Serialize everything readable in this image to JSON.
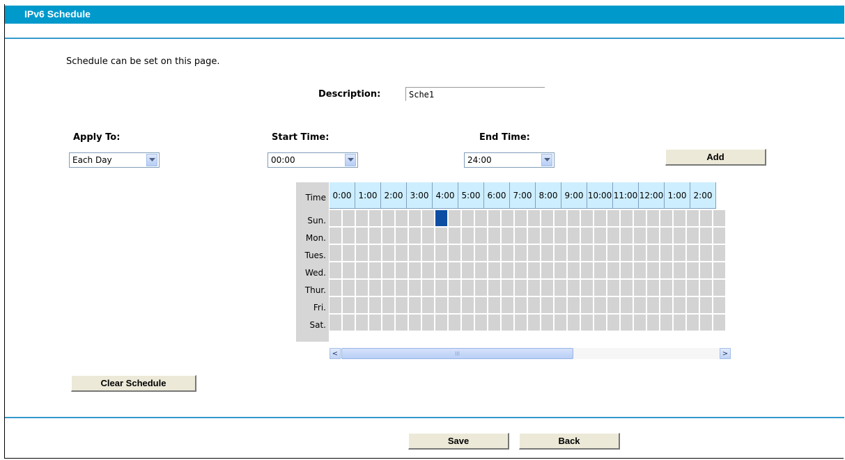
{
  "title": "IPv6 Schedule",
  "intro": "Schedule can be set on this page.",
  "description": {
    "label": "Description:",
    "value": "Sche1"
  },
  "apply_to": {
    "label": "Apply To:",
    "value": "Each Day"
  },
  "start_time": {
    "label": "Start Time:",
    "value": "00:00"
  },
  "end_time": {
    "label": "End Time:",
    "value": "24:00"
  },
  "buttons": {
    "add": "Add",
    "clear": "Clear Schedule",
    "save": "Save",
    "back": "Back"
  },
  "grid": {
    "time_label": "Time",
    "hours": [
      "0:00",
      "1:00",
      "2:00",
      "3:00",
      "4:00",
      "5:00",
      "6:00",
      "7:00",
      "8:00",
      "9:00",
      "10:00",
      "11:00",
      "12:00",
      "1:00",
      "2:00"
    ],
    "days": [
      "Sun.",
      "Mon.",
      "Tues.",
      "Wed.",
      "Thur.",
      "Fri.",
      "Sat."
    ],
    "selected": [
      {
        "day": 0,
        "half_slot": 8
      }
    ]
  },
  "scrollbar": {
    "left_arrow": "<",
    "right_arrow": ">",
    "grip": "III"
  },
  "colors": {
    "header": "#0099CC",
    "selected_cell": "#0D4EA3",
    "hour_header": "#CDEEFE"
  }
}
